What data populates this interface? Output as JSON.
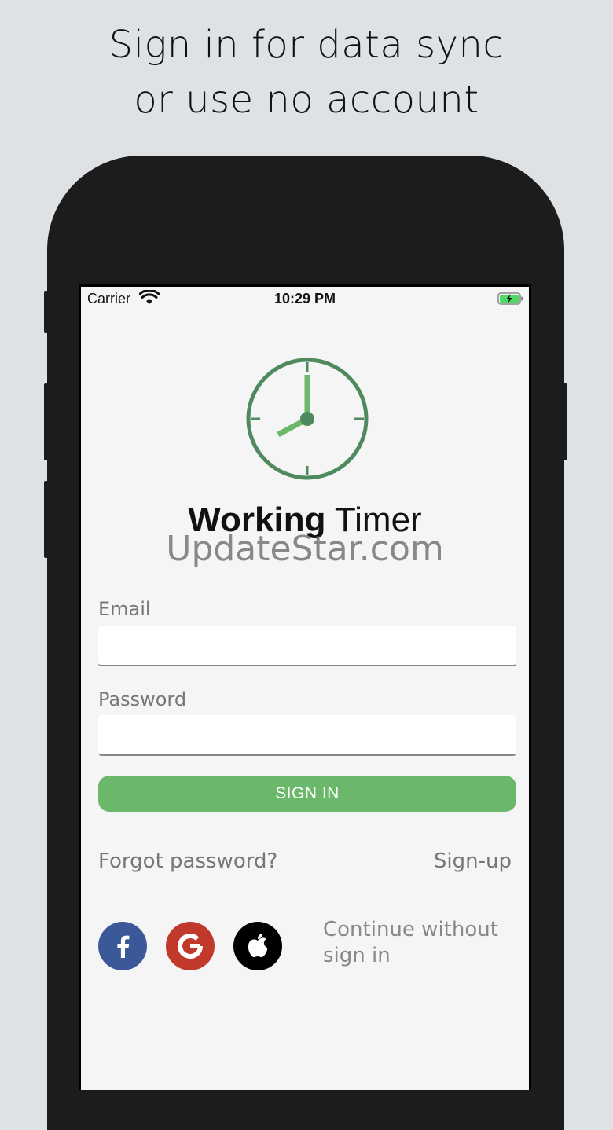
{
  "headline": {
    "line1": "Sign in for data sync",
    "line2": "or use no account"
  },
  "status_bar": {
    "carrier": "Carrier",
    "time": "10:29 PM"
  },
  "app": {
    "name_bold": "Working",
    "name_regular": " Timer"
  },
  "watermark": "UpdateStar.com",
  "form": {
    "email_label": "Email",
    "email_value": "",
    "password_label": "Password",
    "password_value": "",
    "signin_label": "SIGN IN",
    "forgot_label": "Forgot password?",
    "signup_label": "Sign-up"
  },
  "social": {
    "facebook_color": "#3b5998",
    "google_color": "#c0392b",
    "apple_color": "#000000",
    "continue_label": "Continue without sign in"
  },
  "colors": {
    "accent": "#6bb86b",
    "clock_ring": "#4e8a5e",
    "clock_hands": "#6bb86b"
  }
}
